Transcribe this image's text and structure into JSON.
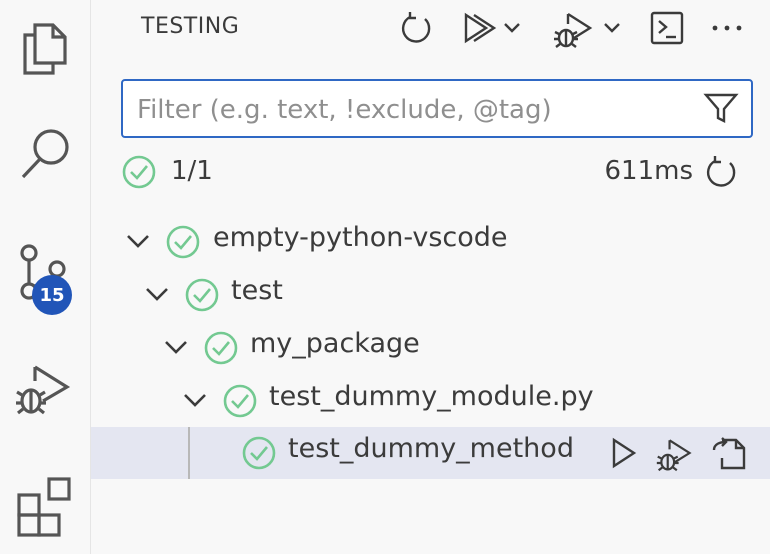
{
  "activity_bar": {
    "items": [
      {
        "icon": "explorer-icon"
      },
      {
        "icon": "search-icon"
      },
      {
        "icon": "source-control-icon",
        "badge": "15"
      },
      {
        "icon": "run-debug-icon"
      },
      {
        "icon": "extensions-icon"
      }
    ]
  },
  "panel": {
    "title": "TESTING",
    "toolbar": [
      "refresh-icon",
      "run-all-icon",
      "run-dropdown-icon",
      "debug-all-icon",
      "debug-dropdown-icon",
      "terminal-icon",
      "more-icon"
    ]
  },
  "filter": {
    "placeholder": "Filter (e.g. text, !exclude, @tag)",
    "value": ""
  },
  "summary": {
    "count": "1/1",
    "duration": "611ms"
  },
  "tree": [
    {
      "label": "empty-python-vscode",
      "status": "passed",
      "expanded": true
    },
    {
      "label": "test",
      "status": "passed",
      "expanded": true
    },
    {
      "label": "my_package",
      "status": "passed",
      "expanded": true
    },
    {
      "label": "test_dummy_module.py",
      "status": "passed",
      "expanded": true
    },
    {
      "label": "test_dummy_method",
      "status": "passed",
      "selected": true
    }
  ],
  "colors": {
    "accent": "#2f68c4",
    "badge": "#2155b8",
    "passed": "#73c991",
    "selected_row": "#e4e6f1"
  }
}
